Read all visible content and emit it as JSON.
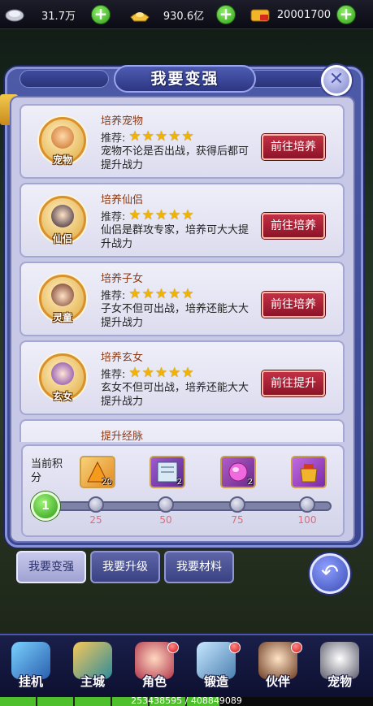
{
  "resources": [
    {
      "icon": "silver-coin-icon",
      "value": "31.7万"
    },
    {
      "icon": "gold-ingot-icon",
      "value": "930.6亿"
    },
    {
      "icon": "vip-gold-icon",
      "value": "20001700"
    }
  ],
  "panel": {
    "title": "我要变强"
  },
  "cards": [
    {
      "title": "培养宠物",
      "recommend_label": "推荐:",
      "stars": "★★★★★",
      "desc": "宠物不论是否出战，获得后都可提升战力",
      "button": "前往培养",
      "avatar_label": "宠物"
    },
    {
      "title": "培养仙侣",
      "recommend_label": "推荐:",
      "stars": "★★★★★",
      "desc": "仙侣是群攻专家，培养可大大提升战力",
      "button": "前往培养",
      "avatar_label": "仙侣"
    },
    {
      "title": "培养子女",
      "recommend_label": "推荐:",
      "stars": "★★★★★",
      "desc": "子女不但可出战，培养还能大大提升战力",
      "button": "前往培养",
      "avatar_label": "灵童"
    },
    {
      "title": "培养玄女",
      "recommend_label": "推荐:",
      "stars": "★★★★★",
      "desc": "玄女不但可出战，培养还能大大提升战力",
      "button": "前往提升",
      "avatar_label": "玄女"
    },
    {
      "title": "提升经脉"
    }
  ],
  "progress": {
    "label": "当前积分",
    "current": "1",
    "fill_fraction": 0.0,
    "chests": [
      {
        "icon": "orange-gem-icon",
        "count": "20"
      },
      {
        "icon": "book-icon",
        "count": "2"
      },
      {
        "icon": "pink-orb-icon",
        "count": "2"
      },
      {
        "icon": "gold-pouch-icon",
        "count": ""
      }
    ],
    "milestones": [
      "25",
      "50",
      "75",
      "100"
    ]
  },
  "tabs": [
    "我要变强",
    "我要升级",
    "我要材料"
  ],
  "nav": [
    "挂机",
    "主城",
    "角色",
    "锻造",
    "伙伴",
    "宠物"
  ],
  "exp": {
    "text": "253438595 / 408849089"
  },
  "colors": {
    "accent": "#c33045",
    "panel": "#4c5aa8",
    "star": "#f0b400"
  }
}
